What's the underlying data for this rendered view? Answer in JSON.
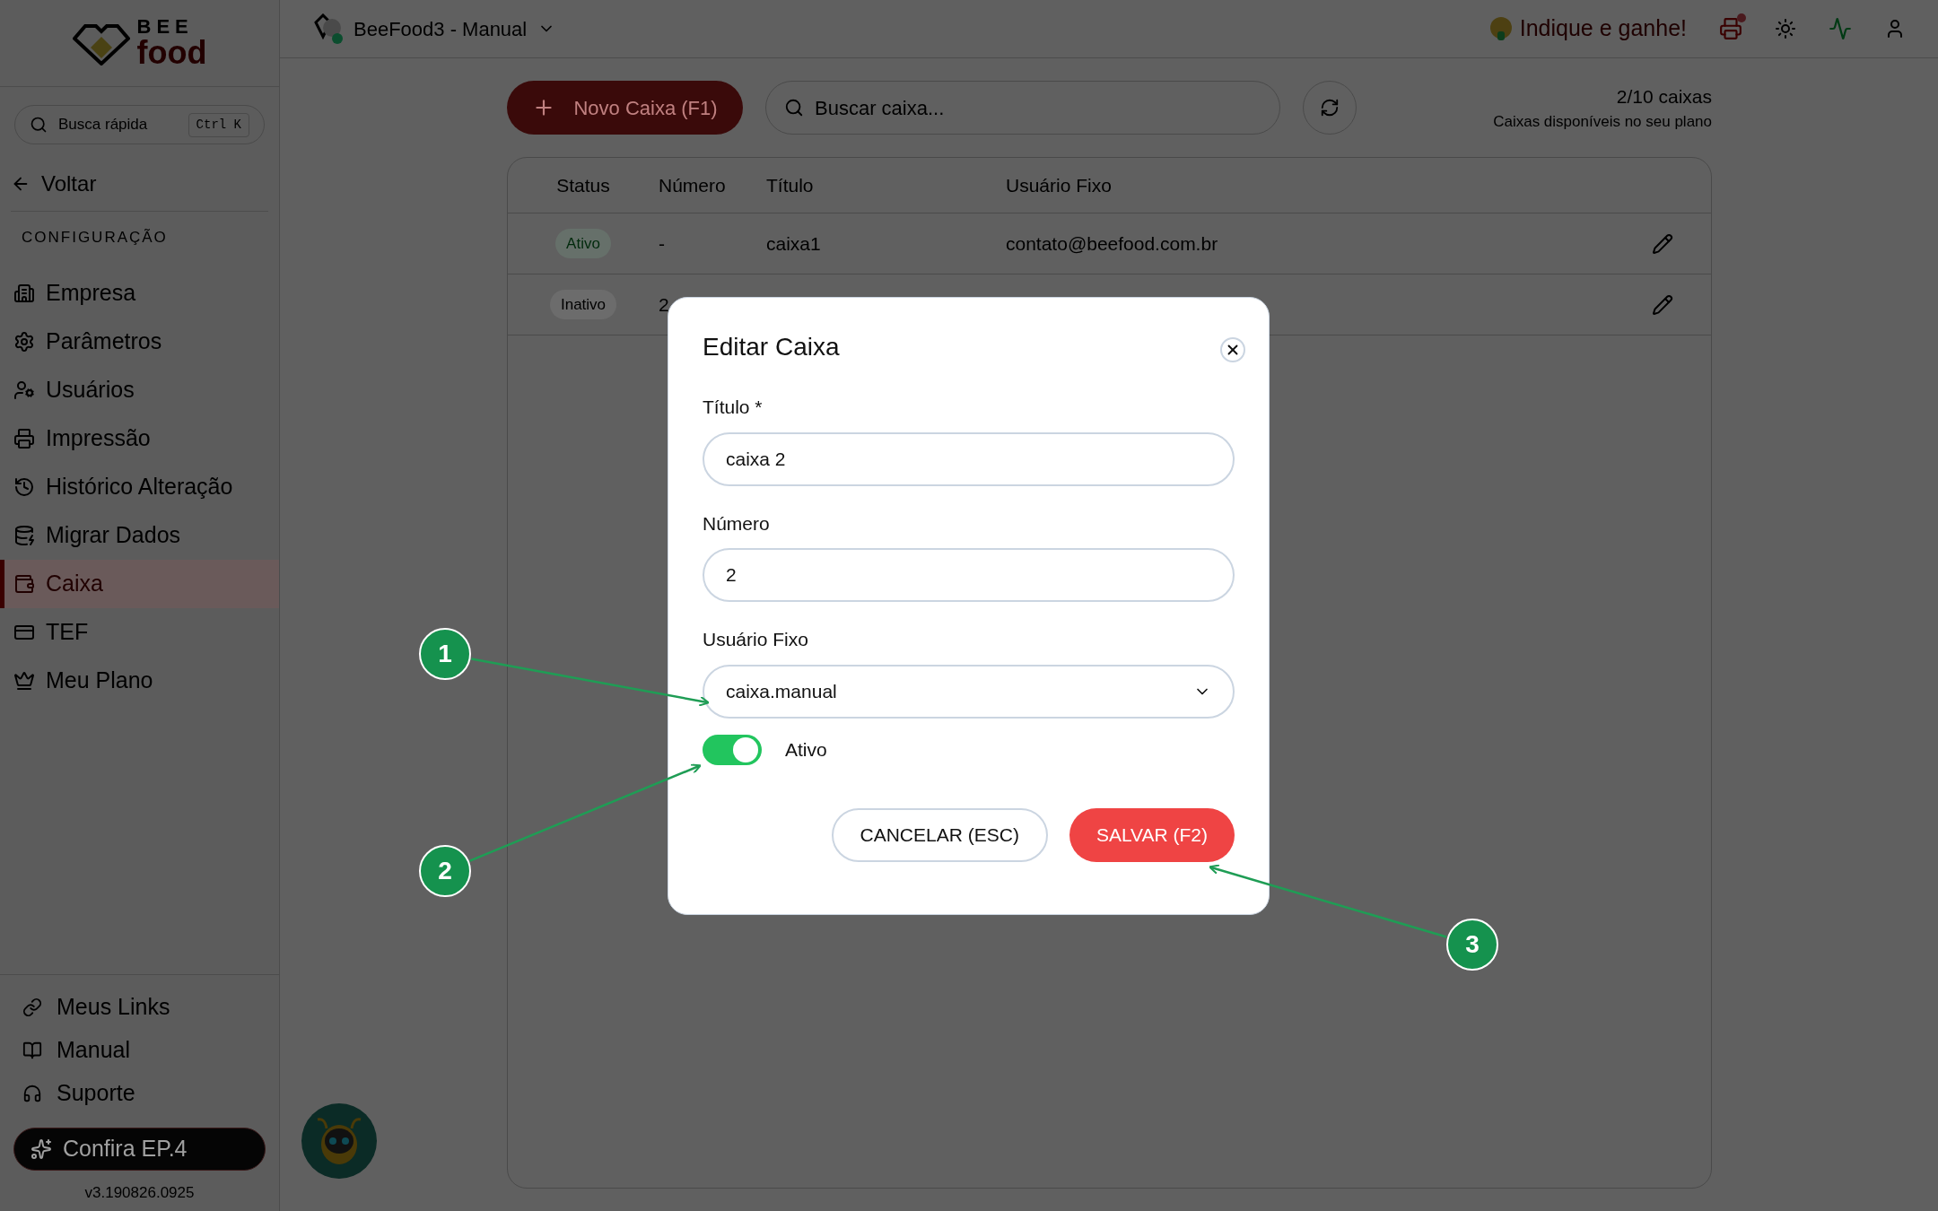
{
  "logo": {
    "top": "BEE",
    "bottom": "food"
  },
  "header": {
    "workspace": "BeeFood3 - Manual",
    "workspace_online": true,
    "referral": "Indique e ganhe!",
    "printer_alert": true
  },
  "sidebar": {
    "search_placeholder": "Busca rápida",
    "shortcut": "Ctrl K",
    "back": "Voltar",
    "section": "CONFIGURAÇÃO",
    "items": [
      {
        "label": "Empresa",
        "selected": false
      },
      {
        "label": "Parâmetros",
        "selected": false
      },
      {
        "label": "Usuários",
        "selected": false
      },
      {
        "label": "Impressão",
        "selected": false
      },
      {
        "label": "Histórico Alteração",
        "selected": false
      },
      {
        "label": "Migrar Dados",
        "selected": false
      },
      {
        "label": "Caixa",
        "selected": true
      },
      {
        "label": "TEF",
        "selected": false
      },
      {
        "label": "Meu Plano",
        "selected": false
      }
    ],
    "footer_links": [
      "Meus Links",
      "Manual",
      "Suporte"
    ],
    "promo": "Confira EP.4",
    "version": "v3.190826.0925"
  },
  "toolbar": {
    "new_button": "Novo Caixa (F1)",
    "search_placeholder": "Buscar caixa...",
    "quota": "2/10 caixas",
    "quota_note": "Caixas disponíveis no seu plano"
  },
  "table": {
    "columns": [
      "Status",
      "Número",
      "Título",
      "Usuário Fixo"
    ],
    "rows": [
      {
        "status": "Ativo",
        "active": true,
        "numero": "-",
        "titulo": "caixa1",
        "usuario": "contato@beefood.com.br"
      },
      {
        "status": "Inativo",
        "active": false,
        "numero": "2"
      }
    ]
  },
  "modal": {
    "title": "Editar Caixa",
    "fields": [
      {
        "kind": "text",
        "label": "Título *",
        "value": "caixa 2"
      },
      {
        "kind": "text",
        "label": "Número",
        "value": "2"
      },
      {
        "kind": "select",
        "label": "Usuário Fixo",
        "value": "caixa.manual"
      }
    ],
    "toggle": {
      "label": "Ativo",
      "on": true
    },
    "cancel": "CANCELAR (ESC)",
    "save": "SALVAR (F2)"
  },
  "annotations": [
    {
      "number": "1"
    },
    {
      "number": "2"
    },
    {
      "number": "3"
    }
  ]
}
